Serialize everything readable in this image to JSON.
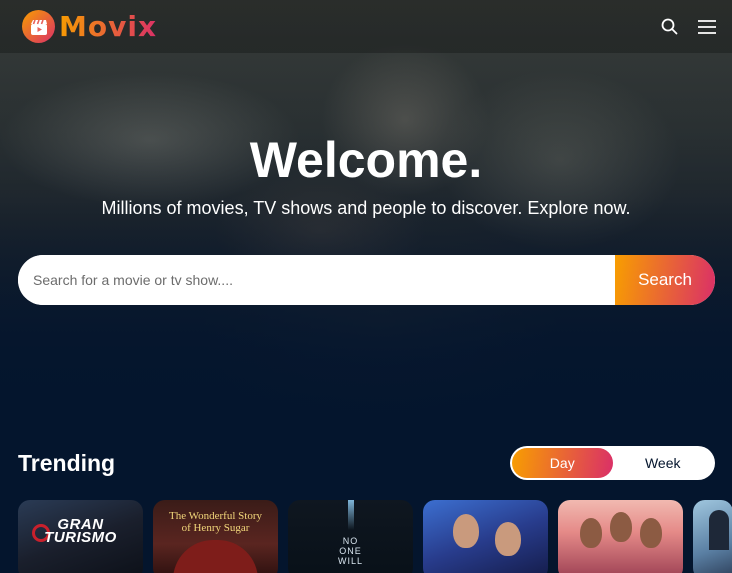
{
  "app": {
    "brand": "Movix",
    "accent_start": "#f89e00",
    "accent_end": "#da2f68",
    "background": "#04152d"
  },
  "header": {
    "logo_icon": "movie-clapper-icon",
    "search_icon": "search-icon",
    "menu_icon": "hamburger-menu-icon"
  },
  "hero": {
    "title": "Welcome.",
    "subtitle": "Millions of movies, TV shows and people to discover. Explore now.",
    "search": {
      "placeholder": "Search for a movie or tv show....",
      "value": "",
      "button_label": "Search"
    }
  },
  "trending": {
    "title": "Trending",
    "tabs": [
      {
        "label": "Day",
        "active": true
      },
      {
        "label": "Week",
        "active": false
      }
    ],
    "posters": [
      {
        "text": "GRAN\nTURISMO"
      },
      {
        "text": "The Wonderful Story\nof Henry Sugar"
      },
      {
        "text": "NO\nONE\nWILL"
      },
      {
        "text": ""
      },
      {
        "text": ""
      },
      {
        "text": ""
      }
    ]
  }
}
